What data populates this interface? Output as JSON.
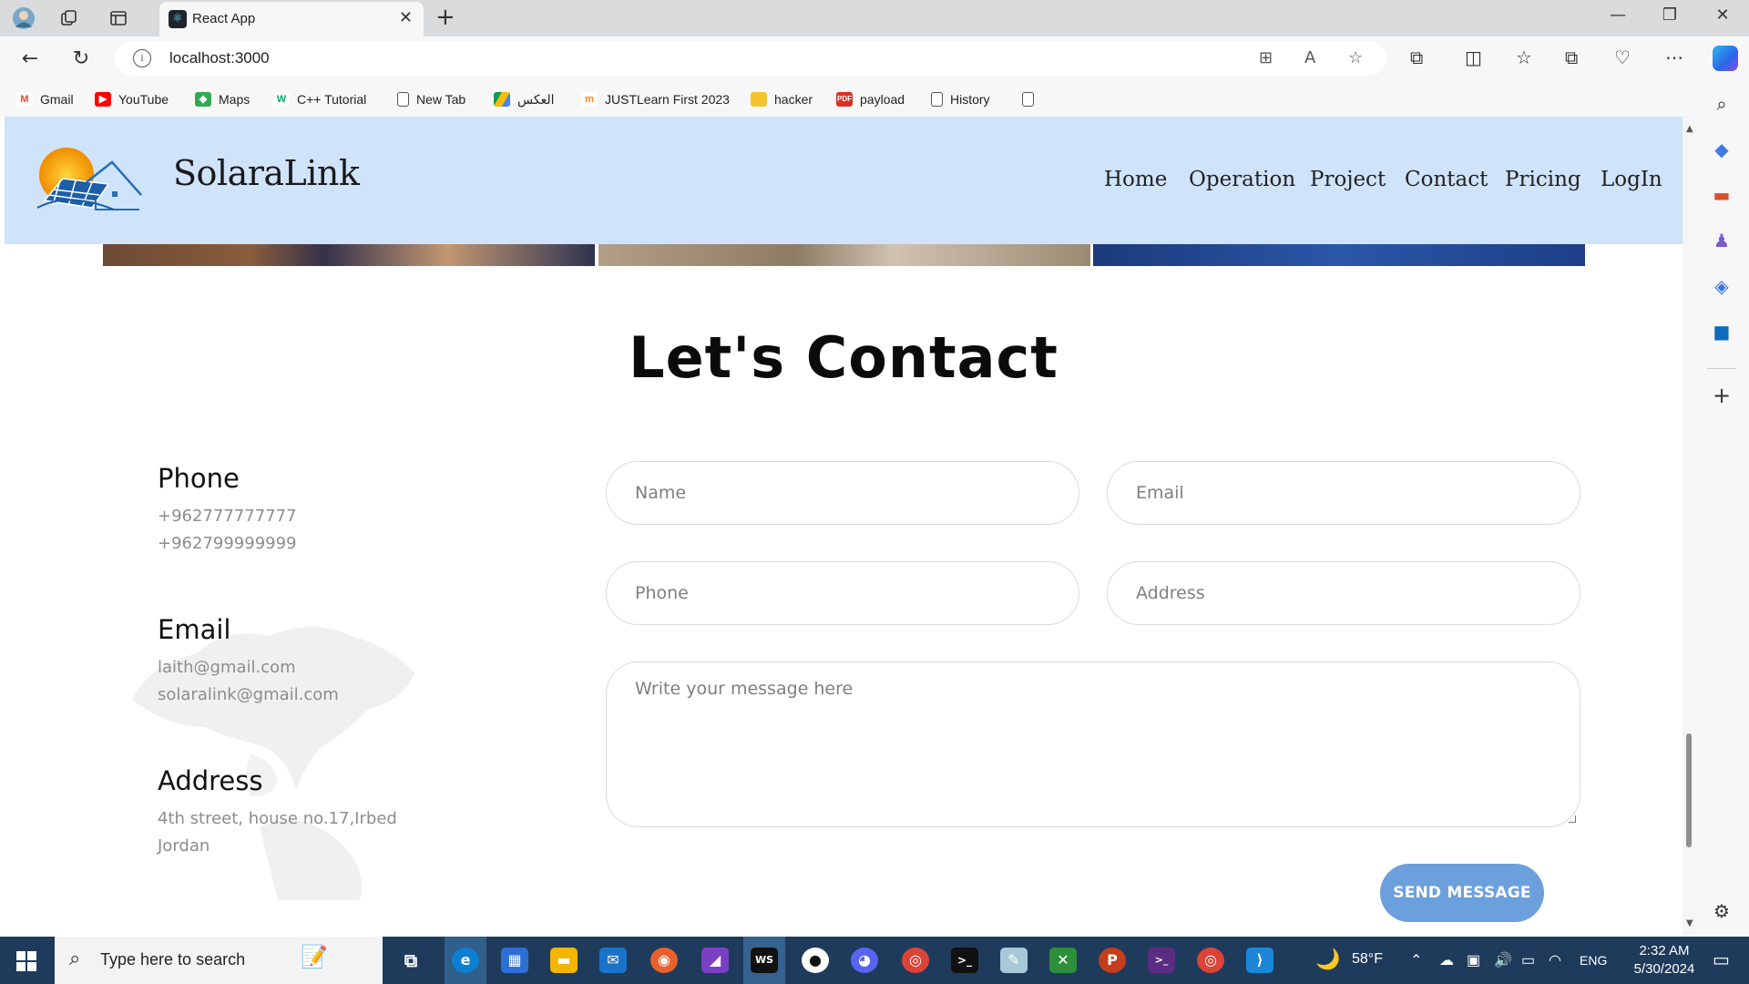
{
  "browser": {
    "tab_title": "React App",
    "url": "localhost:3000",
    "bookmarks": [
      {
        "label": "Gmail",
        "icon": "gmail-icon",
        "color": "#ea4335"
      },
      {
        "label": "YouTube",
        "icon": "youtube-icon",
        "color": "#ff0000"
      },
      {
        "label": "Maps",
        "icon": "maps-icon",
        "color": "#34a853"
      },
      {
        "label": "C++ Tutorial",
        "icon": "w3schools-icon",
        "color": "#04aa6d"
      },
      {
        "label": "New Tab",
        "icon": "page-icon",
        "color": "#666666"
      },
      {
        "label": "العكس",
        "icon": "google-drive-icon",
        "color": "#fbbc04"
      },
      {
        "label": "JUSTLearn First 2023",
        "icon": "moodle-icon",
        "color": "#f98012"
      },
      {
        "label": "hacker",
        "icon": "folder-icon",
        "color": "#f4c430"
      },
      {
        "label": "payload",
        "icon": "pdf-icon",
        "color": "#d93025"
      },
      {
        "label": "History",
        "icon": "page-icon",
        "color": "#666666"
      }
    ]
  },
  "site": {
    "brand": "SolaraLink",
    "nav": [
      "Home",
      "Operation",
      "Project",
      "Contact",
      "Pricing",
      "LogIn"
    ],
    "header_color": "#cfe3fa"
  },
  "contact": {
    "heading": "Let's Contact",
    "phone_title": "Phone",
    "phones": [
      "+962777777777",
      "+962799999999"
    ],
    "email_title": "Email",
    "emails": [
      "laith@gmail.com",
      "solaralink@gmail.com"
    ],
    "address_title": "Address",
    "address_lines": [
      "4th street, house no.17,Irbed",
      "Jordan"
    ]
  },
  "form": {
    "name_placeholder": "Name",
    "email_placeholder": "Email",
    "phone_placeholder": "Phone",
    "address_placeholder": "Address",
    "message_placeholder": "Write your message here",
    "submit_label": "SEND MESSAGE",
    "submit_color": "#6ca0dc"
  },
  "taskbar": {
    "search_placeholder": "Type here to search",
    "weather": "58°F",
    "language": "ENG",
    "time": "2:32 AM",
    "date": "5/30/2024"
  }
}
